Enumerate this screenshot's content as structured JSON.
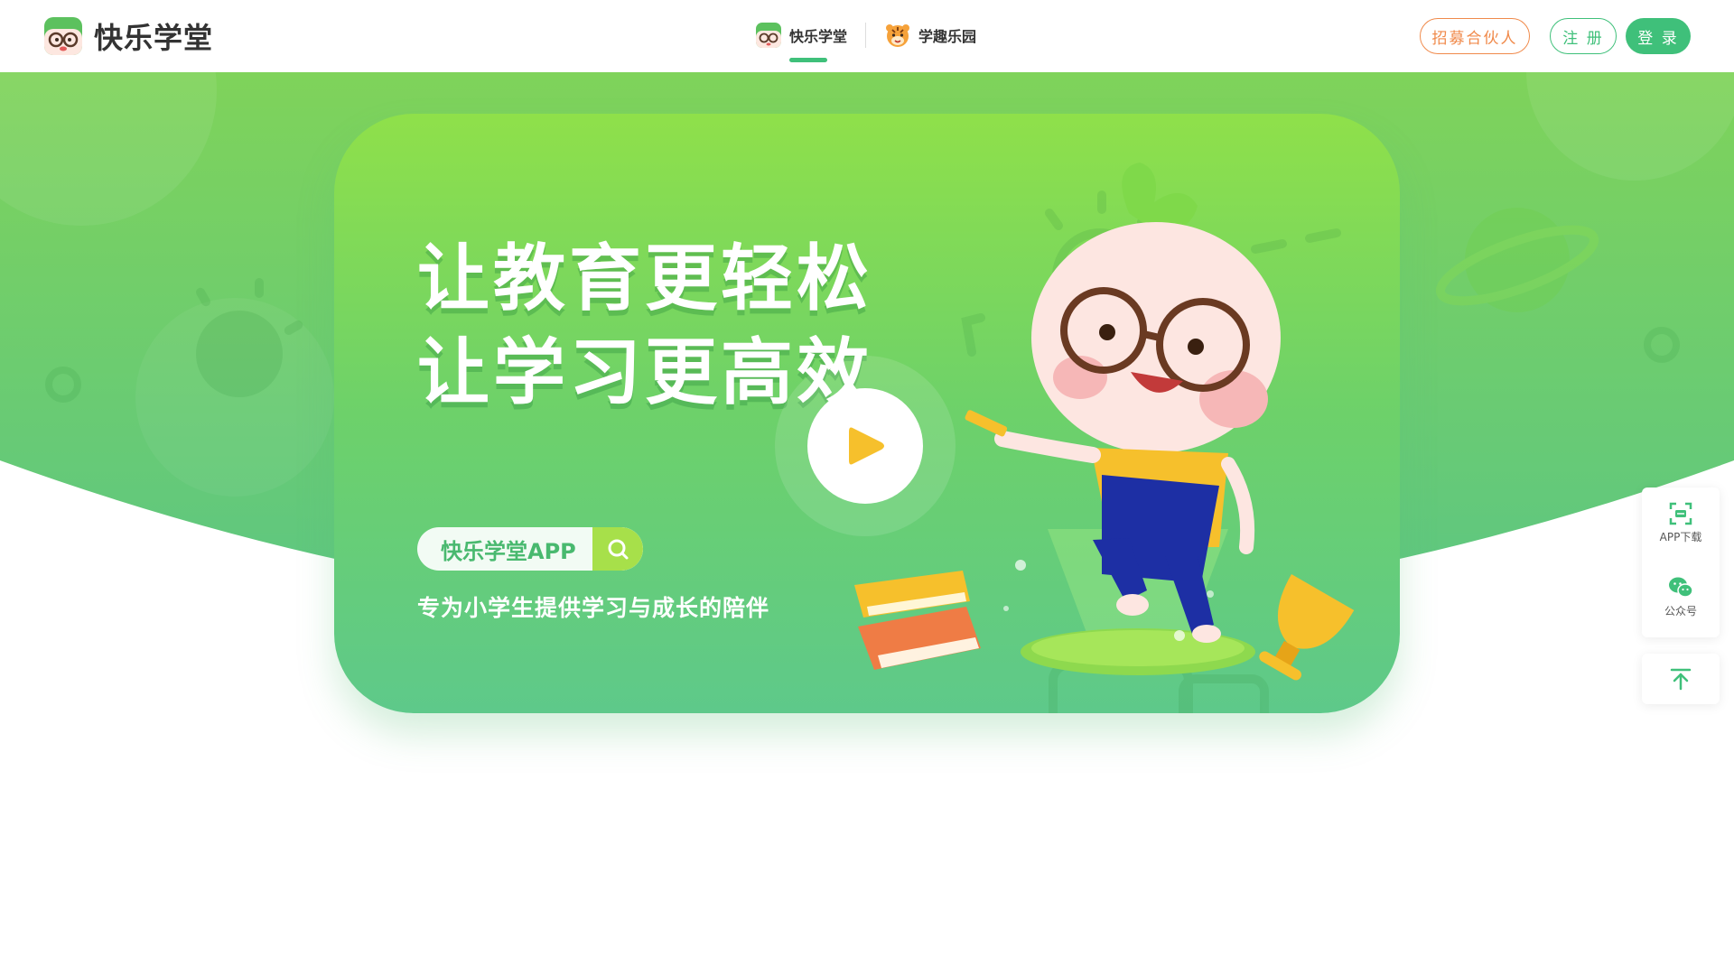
{
  "brand": {
    "name": "快乐学堂",
    "logo_icon": "glasses-kid-logo-icon"
  },
  "nav": {
    "items": [
      {
        "label": "快乐学堂",
        "icon": "glasses-kid-icon",
        "active": true
      },
      {
        "label": "学趣乐园",
        "icon": "tiger-face-icon",
        "active": false
      }
    ]
  },
  "header_buttons": {
    "recruit": "招募合伙人",
    "register": "注 册",
    "login": "登 录"
  },
  "hero": {
    "headline_1": "让教育更轻松",
    "headline_2": "让学习更高效",
    "app_pill": "快乐学堂APP",
    "subline": "专为小学生提供学习与成长的陪伴",
    "play_icon": "play-icon"
  },
  "side_widget": {
    "app_download": "APP下载",
    "wechat": "公众号",
    "back_to_top_icon": "arrow-up-to-top-icon"
  },
  "colors": {
    "accent_green": "#3fc07a",
    "recruit_orange": "#f08a4b",
    "hero_green_top": "#8fe04a",
    "hero_green_bottom": "#5ec98a",
    "play_yellow": "#f6c02c"
  }
}
